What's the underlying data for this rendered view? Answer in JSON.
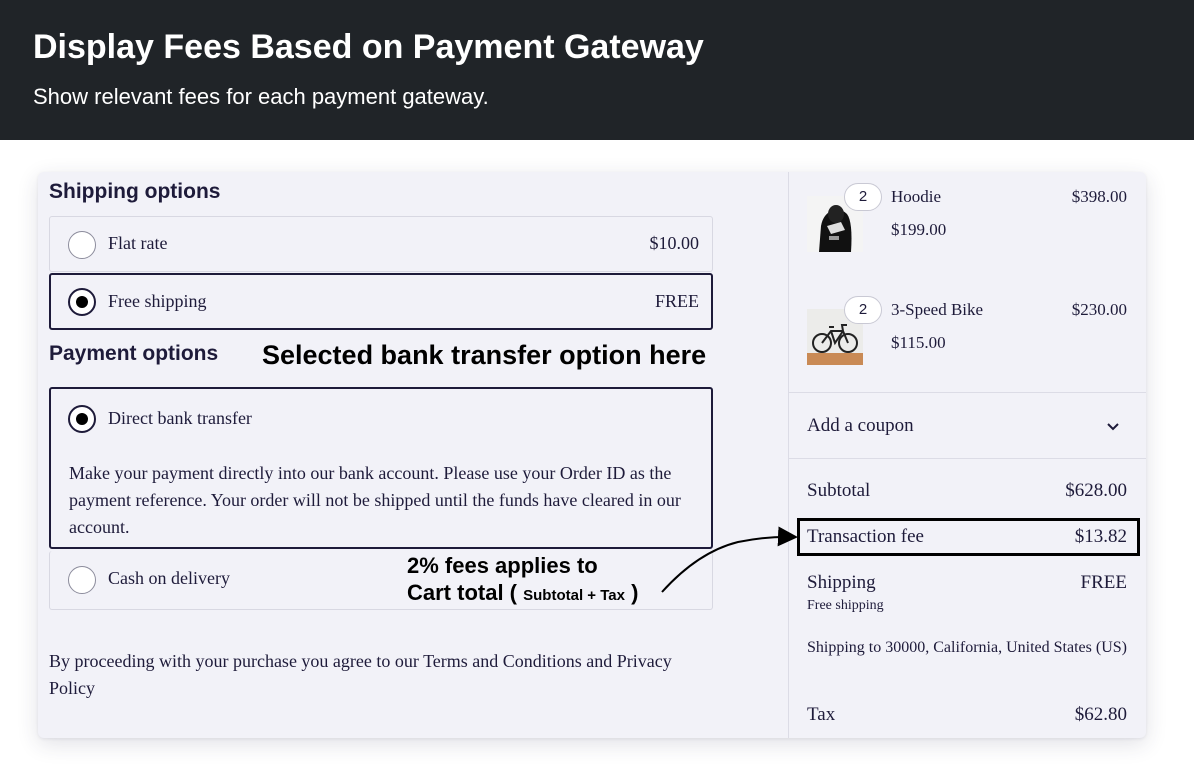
{
  "banner": {
    "title": "Display Fees Based on Payment Gateway",
    "subtitle": "Show relevant fees for each payment gateway."
  },
  "shipping": {
    "heading": "Shipping options",
    "options": [
      {
        "label": "Flat rate",
        "price": "$10.00",
        "selected": false
      },
      {
        "label": "Free shipping",
        "price": "FREE",
        "selected": true
      }
    ]
  },
  "payment": {
    "heading": "Payment options",
    "options": [
      {
        "label": "Direct bank transfer",
        "selected": true,
        "description": "Make your payment directly into our bank account. Please use your Order ID as the payment reference. Your order will not be shipped until the funds have cleared in our account."
      },
      {
        "label": "Cash on delivery",
        "selected": false
      }
    ]
  },
  "annotations": {
    "selected_note": "Selected bank transfer option here",
    "fees_line1": "2% fees applies to",
    "fees_line2_prefix": "Cart total (",
    "fees_line2_small": "Subtotal + Tax",
    "fees_line2_suffix": ")"
  },
  "terms": "By proceeding with your purchase you agree to our Terms and Conditions and Privacy Policy",
  "cart": {
    "items": [
      {
        "qty": "2",
        "name": "Hoodie",
        "unit_price": "$199.00",
        "total": "$398.00",
        "image": "hoodie-photo"
      },
      {
        "qty": "2",
        "name": "3-Speed Bike",
        "unit_price": "$115.00",
        "total": "$230.00",
        "image": "bike-photo"
      }
    ],
    "coupon_label": "Add a coupon",
    "coupon_icon": "chevron-down-icon"
  },
  "totals": {
    "subtotal_label": "Subtotal",
    "subtotal": "$628.00",
    "fee_label": "Transaction fee",
    "fee": "$13.82",
    "shipping_label": "Shipping",
    "shipping": "FREE",
    "shipping_method": "Free shipping",
    "shipping_to": "Shipping to 30000, California, United States (US)",
    "tax_label": "Tax",
    "tax": "$62.80"
  },
  "colors": {
    "banner_bg": "#202428",
    "card_bg": "#f2f2f8",
    "text": "#1e1b3a",
    "selected_border": "#1e1b3a"
  }
}
